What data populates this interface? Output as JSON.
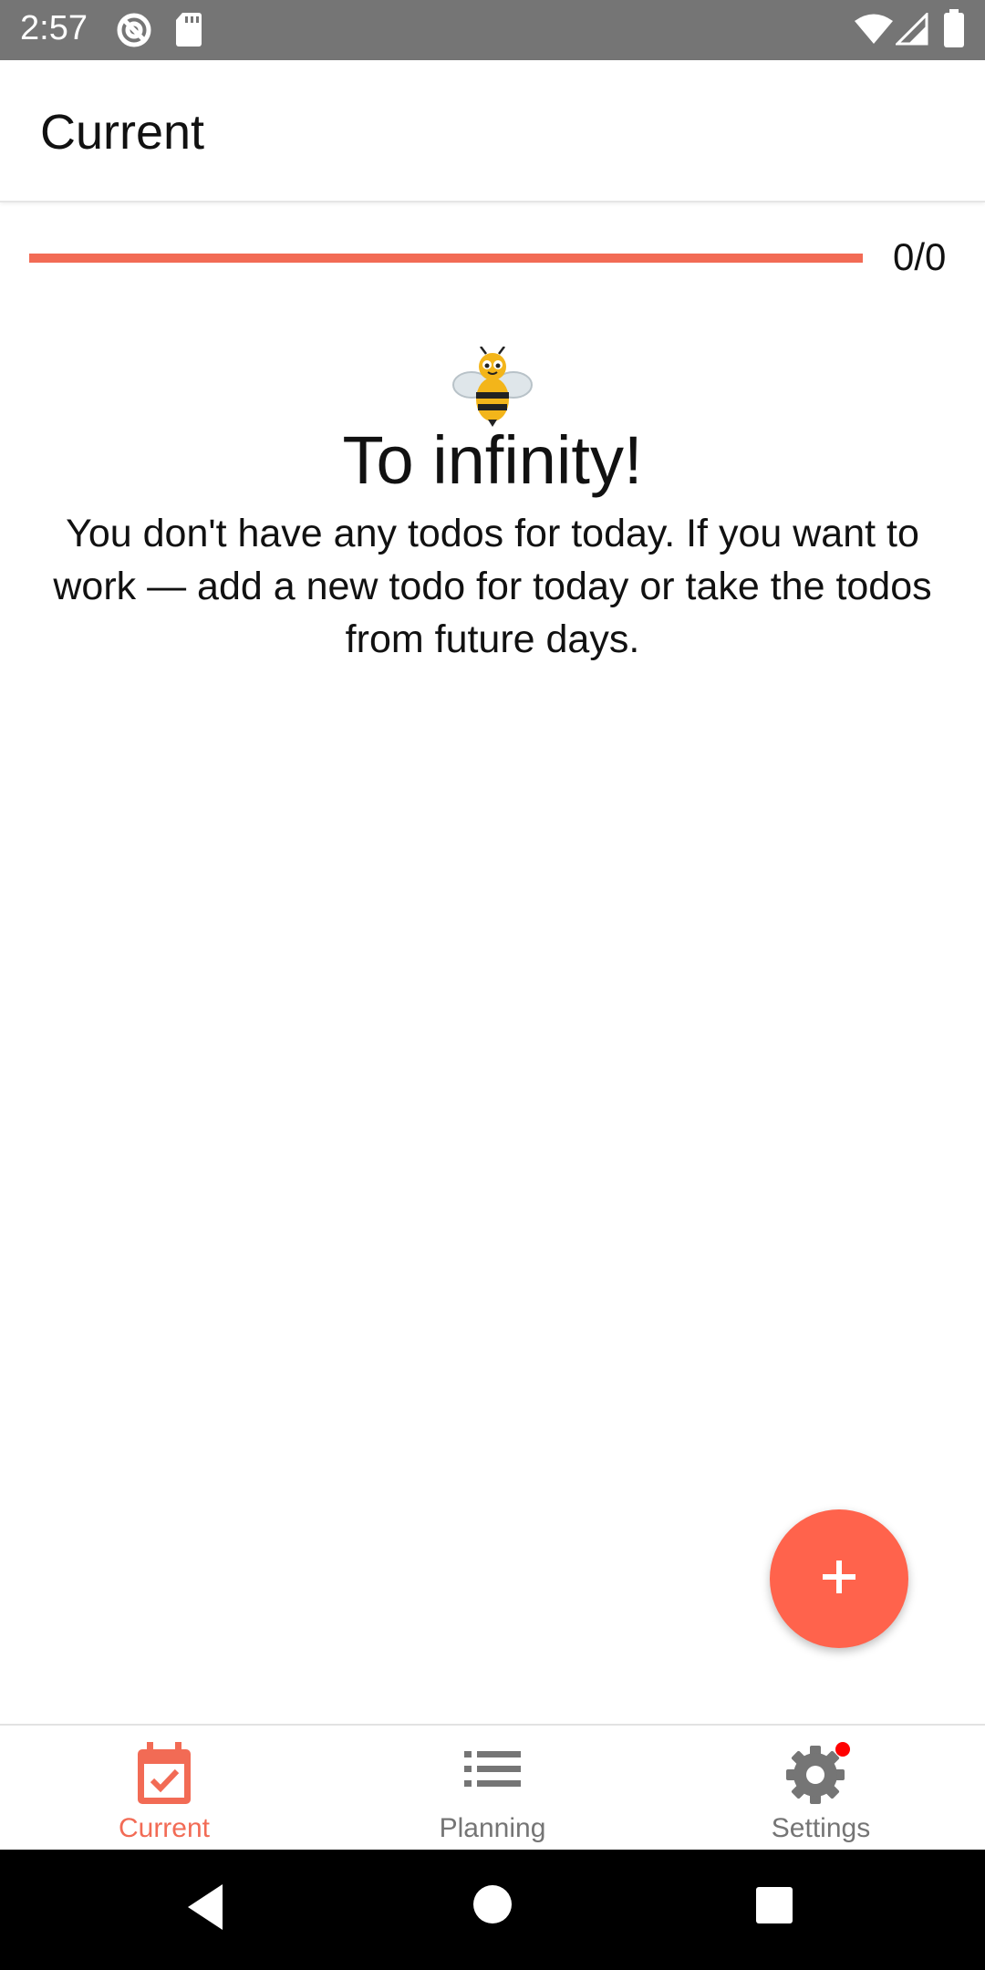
{
  "status_bar": {
    "time": "2:57",
    "icons": [
      "at-sign-icon",
      "sd-card-icon",
      "wifi-icon",
      "signal-icon",
      "battery-icon"
    ]
  },
  "app_bar": {
    "title": "Current"
  },
  "progress": {
    "label": "0/0",
    "completed": 0,
    "total": 0,
    "bar_color": "#f26b55"
  },
  "empty_state": {
    "icon": "bee-icon",
    "title": "To infinity!",
    "message": "You don't have any todos for today. If you want to work — add a new todo for today or take the todos from future days."
  },
  "fab": {
    "icon": "plus-icon",
    "color": "#ff634c"
  },
  "bottom_nav": {
    "items": [
      {
        "label": "Current",
        "icon": "calendar-check-icon",
        "active": true
      },
      {
        "label": "Planning",
        "icon": "list-icon",
        "active": false
      },
      {
        "label": "Settings",
        "icon": "gear-icon",
        "active": false,
        "badge": true
      }
    ],
    "active_color": "#f26b55",
    "inactive_color": "#757575",
    "badge_color": "#ff0000"
  },
  "system_nav": {
    "icons": [
      "back-icon",
      "home-icon",
      "recents-icon"
    ]
  }
}
